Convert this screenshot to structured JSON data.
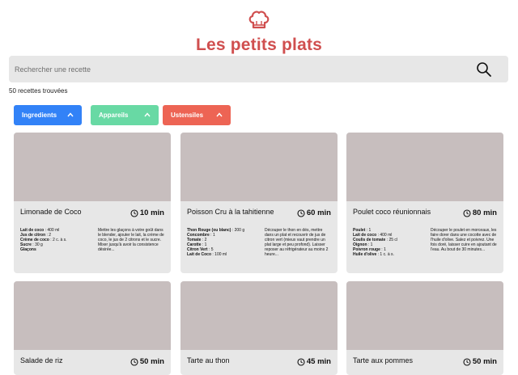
{
  "header": {
    "title": "Les petits plats",
    "logo_icon": "chef-hat-icon"
  },
  "search": {
    "placeholder": "Rechercher une recette",
    "value": "",
    "icon": "search-icon"
  },
  "results": {
    "count_text": "50 recettes trouvées"
  },
  "filters": [
    {
      "label": "Ingredients",
      "color": "#3282F7",
      "icon": "chevron-up-icon"
    },
    {
      "label": "Appareils",
      "color": "#68D9A4",
      "icon": "chevron-up-icon"
    },
    {
      "label": "Ustensiles",
      "color": "#ED6454",
      "icon": "chevron-up-icon"
    }
  ],
  "colors": {
    "brand": "#D04F4F",
    "card_bg": "#E7E7E7",
    "card_image": "#C7BEBE",
    "search_bg": "#E7E7E7"
  },
  "recipes": [
    {
      "name": "Limonade de Coco",
      "time": "10 min",
      "ingredients": [
        {
          "name": "Lait de coco",
          "qty": " : 400 ml"
        },
        {
          "name": "Jus de citron",
          "qty": " : 2"
        },
        {
          "name": "Crème de coco",
          "qty": " : 2 c. à s."
        },
        {
          "name": "Sucre",
          "qty": " : 30 g"
        },
        {
          "name": "Glaçons",
          "qty": ""
        }
      ],
      "description": "Mettre les glaçons à votre goût dans le blender, ajouter le lait, la crème de coco, le jus de 2 citrons et le sucre. Mixer jusqu'à avoir la consistence désirée..."
    },
    {
      "name": "Poisson Cru à la tahitienne",
      "time": "60 min",
      "ingredients": [
        {
          "name": "Thon Rouge (ou blanc)",
          "qty": " : 200 g"
        },
        {
          "name": "Concombre",
          "qty": " : 1"
        },
        {
          "name": "Tomate",
          "qty": " : 2"
        },
        {
          "name": "Carotte",
          "qty": " : 1"
        },
        {
          "name": "Citron Vert",
          "qty": " : 5"
        },
        {
          "name": "Lait de Coco",
          "qty": " : 100 ml"
        }
      ],
      "description": "Découper le thon en dés, mettre dans un plat et recouvrir de jus de citron vert (mieux vaut prendre un plat large et peu profond). Laisser reposer au réfrigérateur au moins 2 heure..."
    },
    {
      "name": "Poulet coco réunionnais",
      "time": "80 min",
      "ingredients": [
        {
          "name": "Poulet",
          "qty": " : 1"
        },
        {
          "name": "Lait de coco",
          "qty": " : 400 ml"
        },
        {
          "name": "Coulis de tomate",
          "qty": " : 25 cl"
        },
        {
          "name": "Oignon",
          "qty": " : 1"
        },
        {
          "name": "Poivron rouge",
          "qty": " : 1"
        },
        {
          "name": "Huile d'olive",
          "qty": " : 1 c. à s."
        }
      ],
      "description": "Découper le poulet en morceaux, les faire dorer dans une cocotte avec de l'huile d'olive. Salez et poivrez. Une fois doré, laisser cuire en ajoutant de l'eau. Au bout de 30 minutes..."
    },
    {
      "name": "Salade de riz",
      "time": "50 min",
      "ingredients": [],
      "description": ""
    },
    {
      "name": "Tarte au thon",
      "time": "45 min",
      "ingredients": [],
      "description": ""
    },
    {
      "name": "Tarte aux pommes",
      "time": "50 min",
      "ingredients": [],
      "description": ""
    }
  ]
}
